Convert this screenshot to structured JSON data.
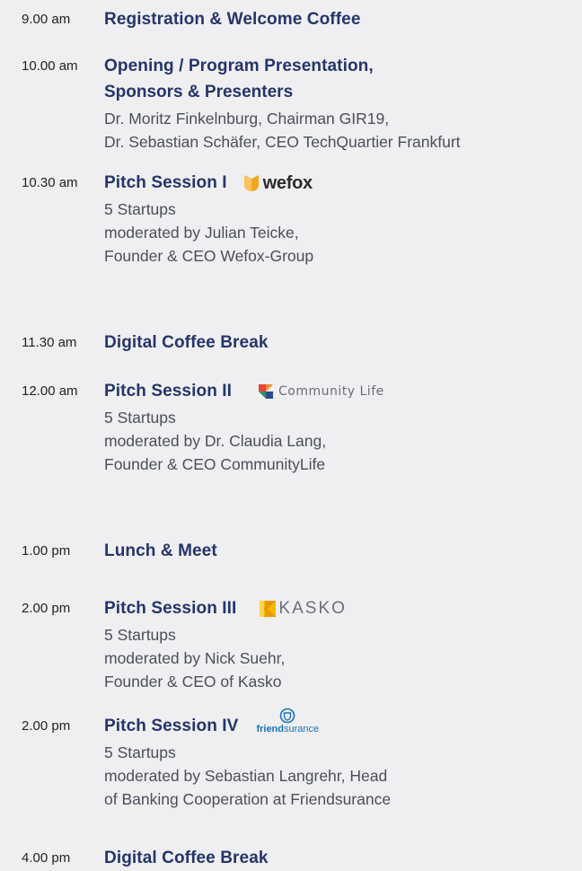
{
  "agenda": [
    {
      "time": "9.00 am",
      "title": "Registration & Welcome Coffee"
    },
    {
      "time": "10.00 am",
      "title": "Opening / Program Presentation,",
      "title2": "Sponsors & Presenters",
      "lines": [
        "Dr. Moritz Finkelnburg, Chairman GIR19,",
        "Dr. Sebastian Schäfer, CEO TechQuartier Frankfurt"
      ]
    },
    {
      "time": "10.30 am",
      "title": "Pitch Session I",
      "logo_text": "wefox",
      "lines": [
        "5 Startups",
        "moderated by Julian Teicke,",
        "Founder & CEO Wefox-Group"
      ]
    },
    {
      "time": "11.30 am",
      "title": "Digital Coffee Break"
    },
    {
      "time": "12.00 am",
      "title": "Pitch Session II",
      "logo_text": "Community Life",
      "lines": [
        "5 Startups",
        "moderated by Dr. Claudia Lang,",
        "Founder & CEO CommunityLife"
      ]
    },
    {
      "time": "1.00 pm",
      "title": "Lunch & Meet"
    },
    {
      "time": "2.00 pm",
      "title": "Pitch Session III",
      "logo_text": "KASKO",
      "lines": [
        "5 Startups",
        "moderated by Nick Suehr,",
        "Founder & CEO of Kasko"
      ]
    },
    {
      "time": "2.00 pm",
      "title": "Pitch Session IV",
      "logo_text_bold": "friend",
      "logo_text_rest": "surance",
      "lines": [
        "5 Startups",
        "moderated by Sebastian Langrehr, Head",
        "of Banking Cooperation at Friendsurance"
      ]
    },
    {
      "time": "4.00 pm",
      "title": "Digital Coffee Break"
    }
  ],
  "colors": {
    "background": "#efeff1",
    "title": "#24356a",
    "text": "#4a4f5c",
    "wefox_logo": "#f2a71b",
    "kasko_logo": "#f5b800",
    "friendsurance_logo": "#1a73b8"
  },
  "icons": [
    "wefox-logo-icon",
    "community-life-logo-icon",
    "kasko-logo-icon",
    "friendsurance-logo-icon"
  ]
}
